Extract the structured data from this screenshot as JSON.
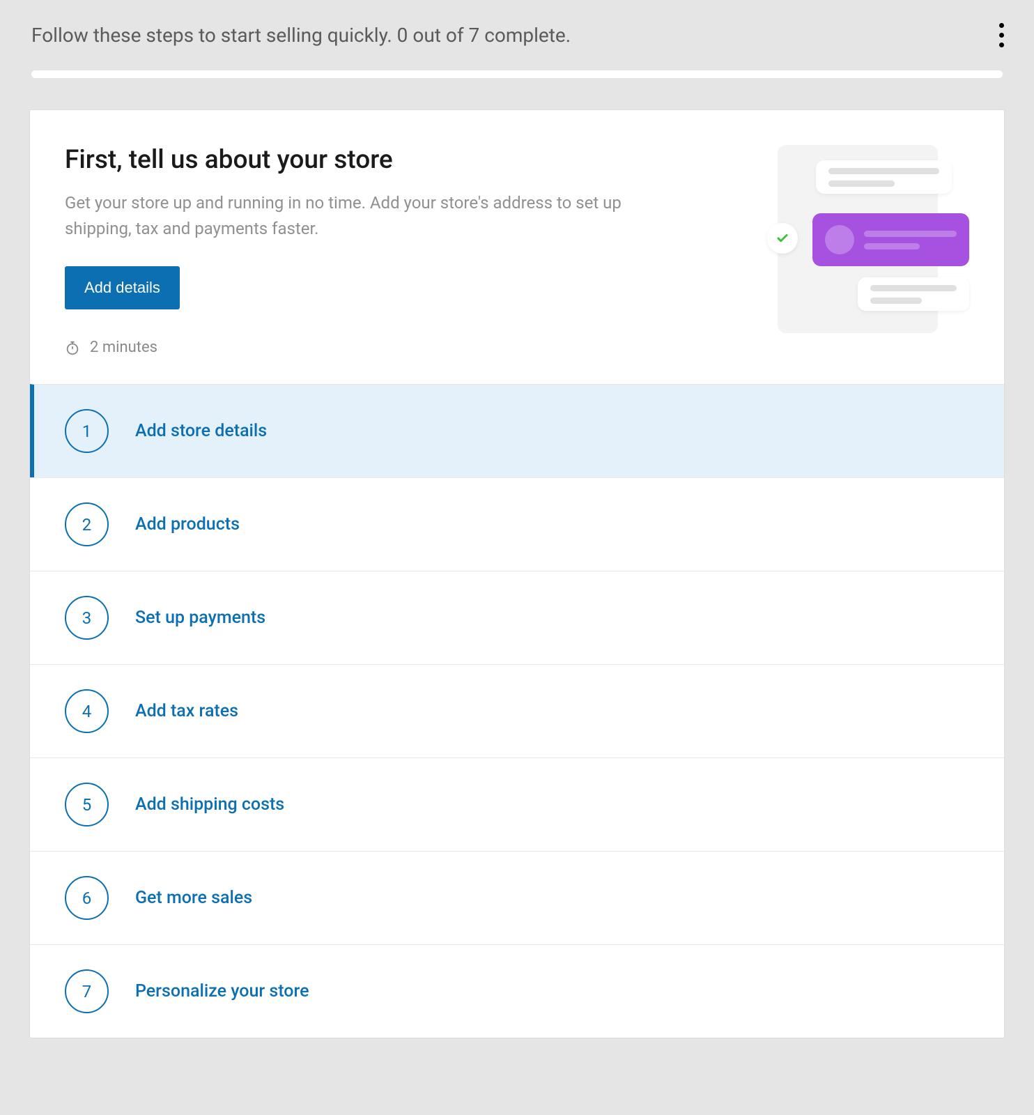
{
  "header": {
    "instruction": "Follow these steps to start selling quickly. 0 out of 7 complete."
  },
  "card": {
    "title": "First, tell us about your store",
    "subtitle": "Get your store up and running in no time. Add your store's address to set up shipping, tax and payments faster.",
    "button_label": "Add details",
    "time_estimate": "2 minutes"
  },
  "steps": [
    {
      "num": "1",
      "label": "Add store details",
      "active": true
    },
    {
      "num": "2",
      "label": "Add products",
      "active": false
    },
    {
      "num": "3",
      "label": "Set up payments",
      "active": false
    },
    {
      "num": "4",
      "label": "Add tax rates",
      "active": false
    },
    {
      "num": "5",
      "label": "Add shipping costs",
      "active": false
    },
    {
      "num": "6",
      "label": "Get more sales",
      "active": false
    },
    {
      "num": "7",
      "label": "Personalize your store",
      "active": false
    }
  ]
}
